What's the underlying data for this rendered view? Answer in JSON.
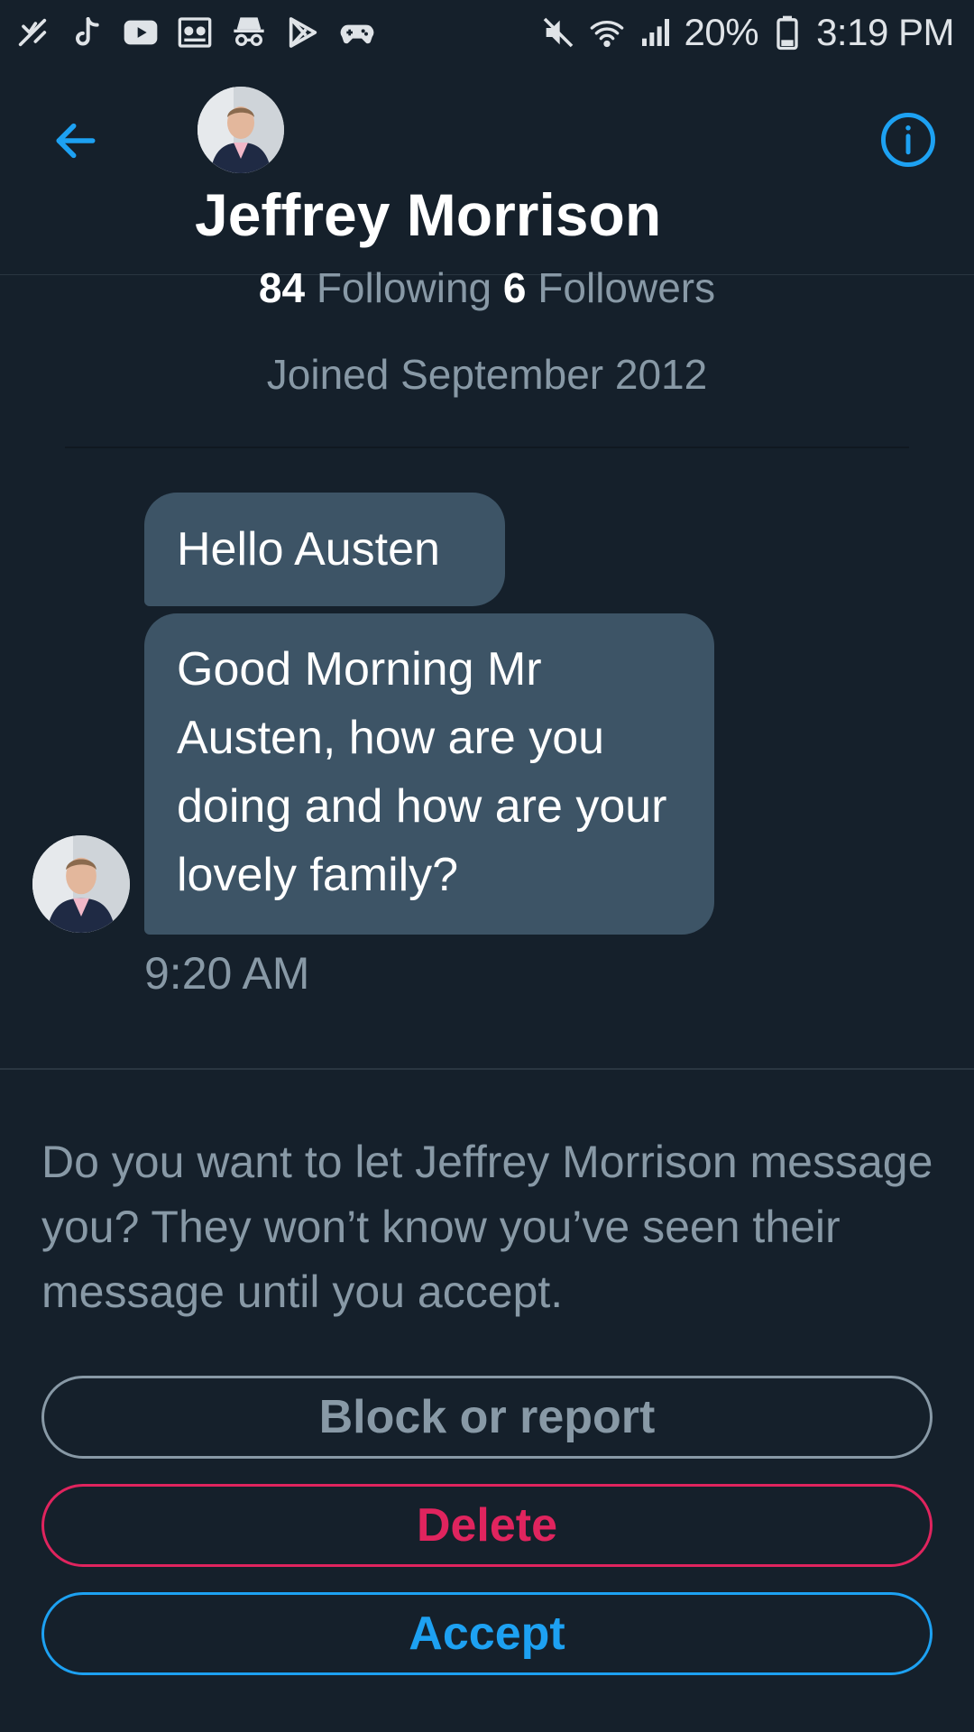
{
  "status_bar": {
    "left_icons": [
      "missed-call-icon",
      "tiktok-icon",
      "youtube-icon",
      "meetup-icon",
      "incognito-icon",
      "play-store-icon",
      "gamepad-icon"
    ],
    "right_icons": [
      "mute-icon",
      "wifi-icon",
      "signal-icon",
      "battery-icon"
    ],
    "battery": "20%",
    "time": "3:19 PM"
  },
  "header": {
    "name": "Jeffrey Morrison",
    "back_icon": "back-arrow-icon",
    "info_icon": "info-icon"
  },
  "profile": {
    "following_count": "84",
    "following_label": "Following",
    "followers_count": "6",
    "followers_label": "Followers",
    "joined": "Joined September 2012"
  },
  "messages": [
    {
      "text": "Hello Austen"
    },
    {
      "text": "Good Morning Mr Austen, how are you doing and how are your lovely family?"
    }
  ],
  "message_time": "9:20 AM",
  "request": {
    "prompt": "Do you want to let Jeffrey Morrison message you? They won’t know you’ve seen their message until you accept.",
    "block_label": "Block or report",
    "delete_label": "Delete",
    "accept_label": "Accept"
  },
  "colors": {
    "background": "#15202b",
    "bubble": "#3d5466",
    "secondary_text": "#8899a6",
    "accent": "#1da1f2",
    "danger": "#e0245e"
  }
}
